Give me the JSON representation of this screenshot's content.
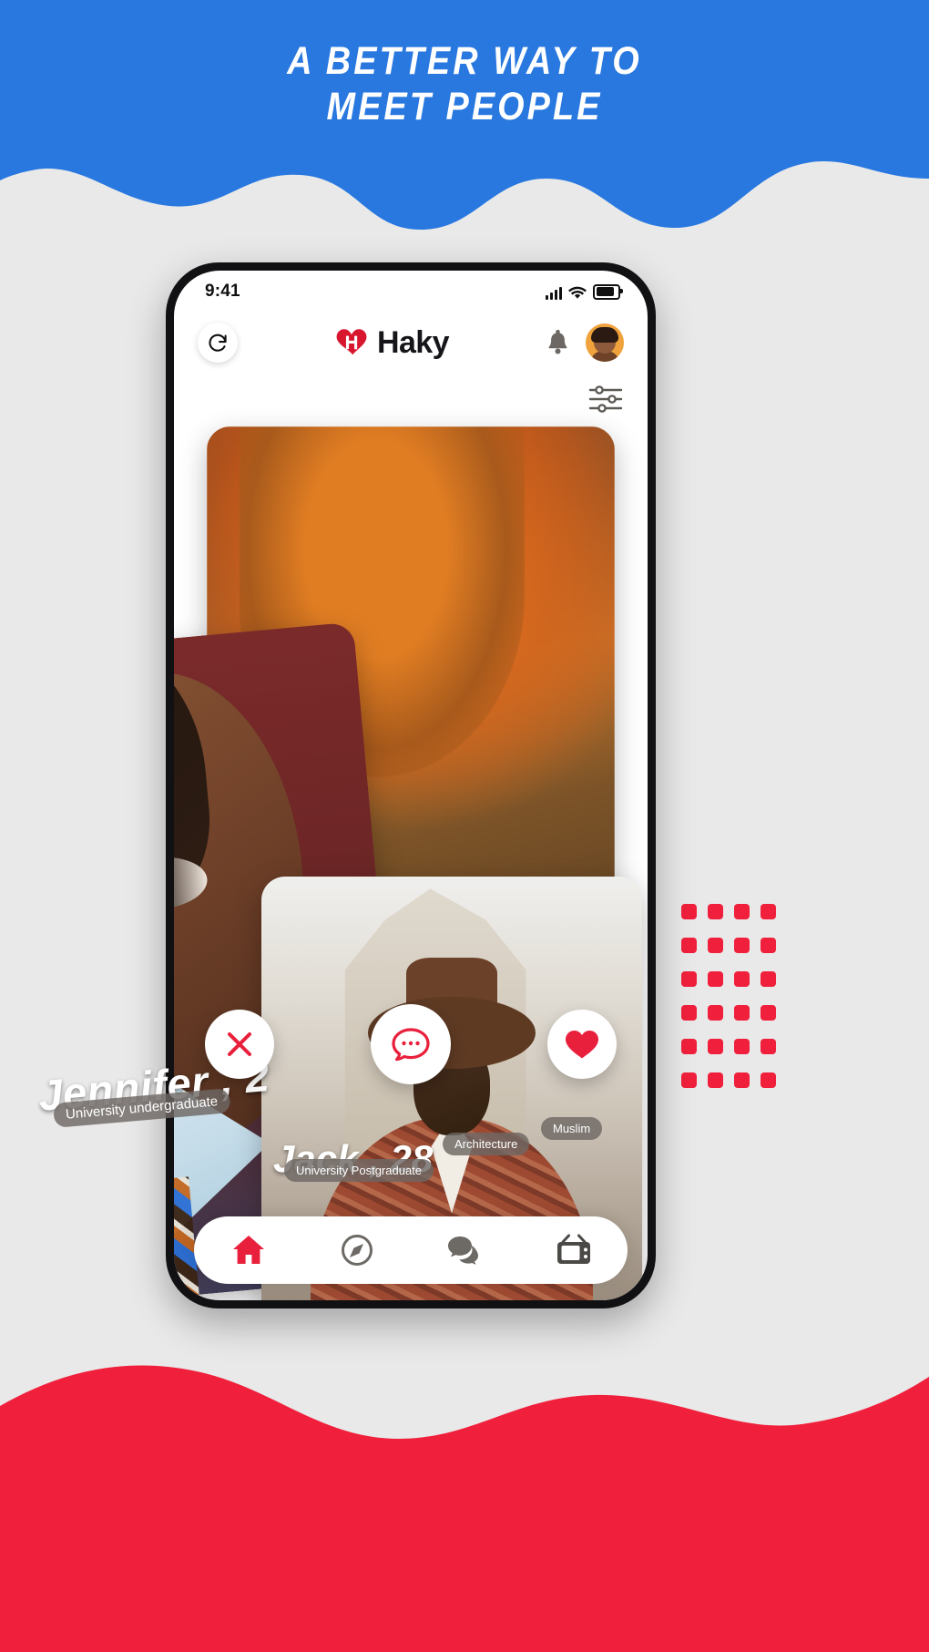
{
  "promo": {
    "headline": "A BETTER WAY TO\nMEET PEOPLE",
    "blue": "#2878e0",
    "red": "#f0203c",
    "background": "#e9e9e9"
  },
  "phone": {
    "status_bar": {
      "time": "9:41",
      "signal_icon": "cellular-signal-icon",
      "wifi_icon": "wifi-icon",
      "battery_icon": "battery-icon"
    },
    "app_header": {
      "refresh_icon": "refresh-icon",
      "logo_icon": "haky-heart-logo-icon",
      "brand": "Haky",
      "notification_icon": "bell-icon",
      "avatar_icon": "user-avatar"
    },
    "filter_icon": "sliders-filter-icon",
    "cards": [
      {
        "name": "Jennifer , 2",
        "tags": [
          "University undergraduate"
        ],
        "photo": "woman-portrait-photo"
      },
      {
        "name": "",
        "tags": [],
        "photo": "redhead-portrait-photo"
      },
      {
        "name": "Jack , 28",
        "tags": [
          "University Postgraduate",
          "Architecture",
          "Muslim"
        ],
        "photo": "man-in-hat-portrait-photo"
      }
    ],
    "actions": [
      {
        "id": "dislike",
        "icon": "close-x-icon",
        "color": "#e8203c"
      },
      {
        "id": "message",
        "icon": "chat-bubble-icon",
        "color": "#e8203c"
      },
      {
        "id": "like",
        "icon": "heart-icon",
        "color": "#e8203c"
      }
    ],
    "nav": [
      {
        "id": "home",
        "icon": "home-icon",
        "active": true,
        "color": "#e8203c"
      },
      {
        "id": "discover",
        "icon": "compass-icon",
        "active": false,
        "color": "#6d6a66"
      },
      {
        "id": "chats",
        "icon": "chats-icon",
        "active": false,
        "color": "#6d6a66"
      },
      {
        "id": "live",
        "icon": "tv-icon",
        "active": false,
        "color": "#4c4a47"
      }
    ]
  },
  "decor": {
    "dot_count": 24,
    "dot_color": "#f0203c"
  }
}
